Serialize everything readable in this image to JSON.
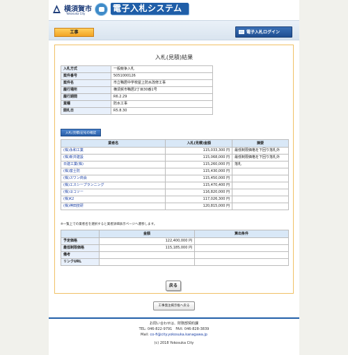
{
  "header": {
    "city_name": "横須賀市",
    "city_name_en": "Yokosuka City",
    "system_title": "電子入札システム"
  },
  "nav": {
    "tab_label": "工事",
    "login_label": "電子入札ログイン"
  },
  "page_title": "入札(見積)結果",
  "info": [
    {
      "label": "入札方式",
      "value": "一般競争入札"
    },
    {
      "label": "案件番号",
      "value": "5051000126"
    },
    {
      "label": "案件名",
      "value": "市立鴨居中学校屋上防水改修工事"
    },
    {
      "label": "履行場所",
      "value": "横須賀市鴨居2丁目30番1号"
    },
    {
      "label": "履行期間",
      "value": "R6.2.29"
    },
    {
      "label": "業種",
      "value": "防水工事"
    },
    {
      "label": "開札日",
      "value": "R5.8.30"
    }
  ],
  "bid_history_button": "入札(見積)記号の確認",
  "results": {
    "headers": [
      "業者名",
      "入札(見積)金額",
      "摘要"
    ],
    "rows": [
      {
        "name": "(株)永和工業",
        "amount": "115,033,300 円",
        "note": "最低制限価格を下回り落札外"
      },
      {
        "name": "(株)新井建設",
        "amount": "115,068,000 円",
        "note": "最低制限価格を下回り落札外"
      },
      {
        "name": "日建工業(株)",
        "amount": "115,260,000 円",
        "note": "落札"
      },
      {
        "name": "(株)富士防",
        "amount": "115,430,000 円",
        "note": ""
      },
      {
        "name": "(株)スワン商会",
        "amount": "115,450,000 円",
        "note": ""
      },
      {
        "name": "(株)エスシープランニング",
        "amount": "115,470,400 円",
        "note": ""
      },
      {
        "name": "(株)ヨコソー",
        "amount": "116,820,000 円",
        "note": ""
      },
      {
        "name": "(株)K2",
        "amount": "117,026,300 円",
        "note": ""
      },
      {
        "name": "(株)神田技研",
        "amount": "120,815,000 円",
        "note": ""
      }
    ]
  },
  "note_text": "※一覧上での業者名を選択すると業者詳細表示ページへ遷移します。",
  "price": {
    "headers": [
      "",
      "金額",
      "算出条件"
    ],
    "rows": [
      {
        "label": "予定価格",
        "amount": "122,400,000 円",
        "cond": ""
      },
      {
        "label": "最低制限価格",
        "amount": "115,185,000 円",
        "cond": ""
      },
      {
        "label": "備考",
        "amount": "",
        "cond": ""
      },
      {
        "label": "リンクURL",
        "amount": "",
        "cond": ""
      }
    ]
  },
  "back_button": "戻る",
  "list_button": "工事発注掲示板へ戻る",
  "footer": {
    "contact": "お問い合わせは、財務部契約課",
    "tel": "TEL: 046-822-9791　FAX: 046-828-3839",
    "mail_label": "Mail: ",
    "mail": "co-fi@city.yokosuka.kanagawa.jp",
    "copyright": "(c) 2018 Yokosuka City"
  },
  "colors": {
    "brand": "#1f5ea8",
    "tab_orange": "#f2a323",
    "link": "#1a3fa4"
  }
}
